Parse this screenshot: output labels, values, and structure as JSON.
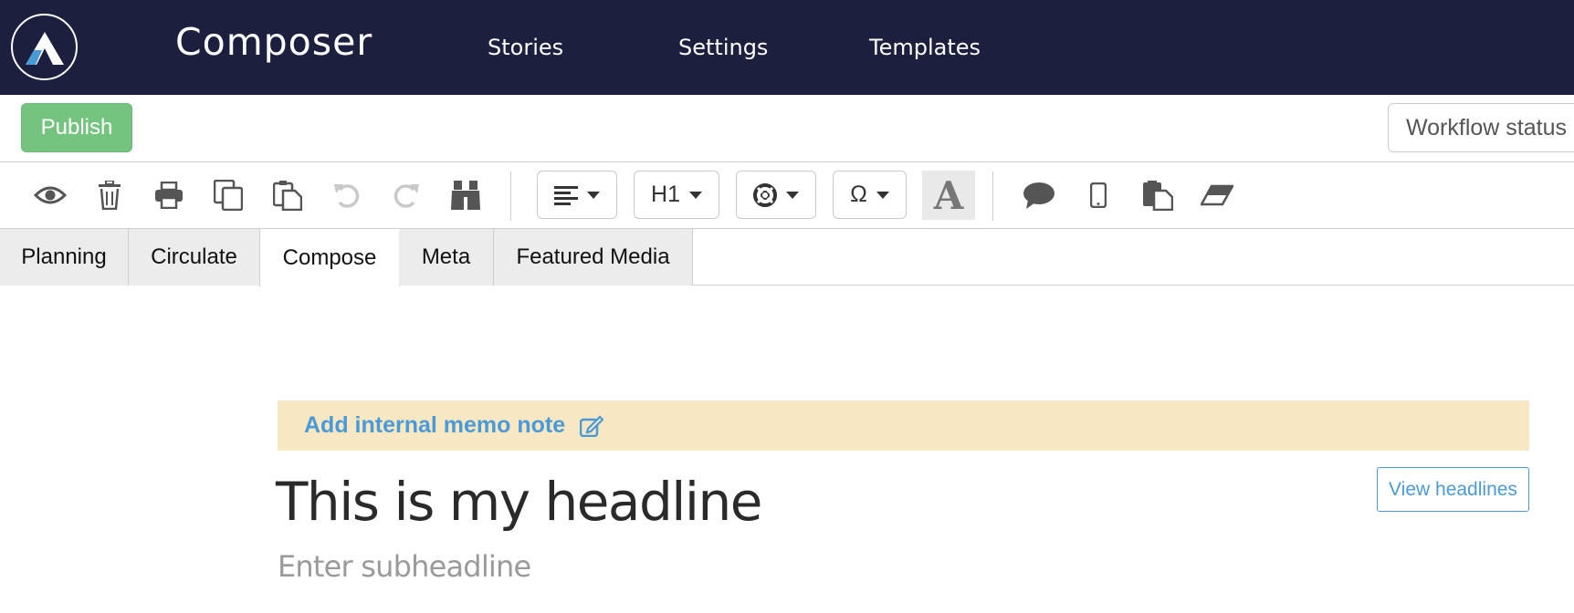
{
  "nav": {
    "brand": "Composer",
    "links": [
      "Stories",
      "Settings",
      "Templates"
    ],
    "logo_icon": "composer-logo-icon"
  },
  "actions": {
    "publish_label": "Publish",
    "workflow_label": "Workflow status"
  },
  "toolbar": {
    "icons": [
      "eye-icon",
      "trash-icon",
      "print-icon",
      "copy-icon",
      "paste-icon",
      "undo-icon",
      "redo-icon",
      "binoculars-icon"
    ],
    "align_icon": "align-left-icon",
    "heading_label": "H1",
    "help_icon": "lifebuoy-icon",
    "special_char_label": "Ω",
    "font_label": "A",
    "right_icons": [
      "comment-icon",
      "mobile-icon",
      "clipboard-icon",
      "eraser-icon"
    ]
  },
  "tabs": {
    "items": [
      "Planning",
      "Circulate",
      "Compose",
      "Meta",
      "Featured Media"
    ],
    "active": "Compose"
  },
  "editor": {
    "memo_label": "Add internal memo note",
    "view_headlines_label": "View headlines",
    "headline": "This is my headline",
    "subheadline_placeholder": "Enter subheadline"
  },
  "colors": {
    "nav_bg": "#1c1f3e",
    "publish_green": "#74c47f",
    "link_blue": "#4a9ad8",
    "memo_bg": "#f8e7c3"
  }
}
